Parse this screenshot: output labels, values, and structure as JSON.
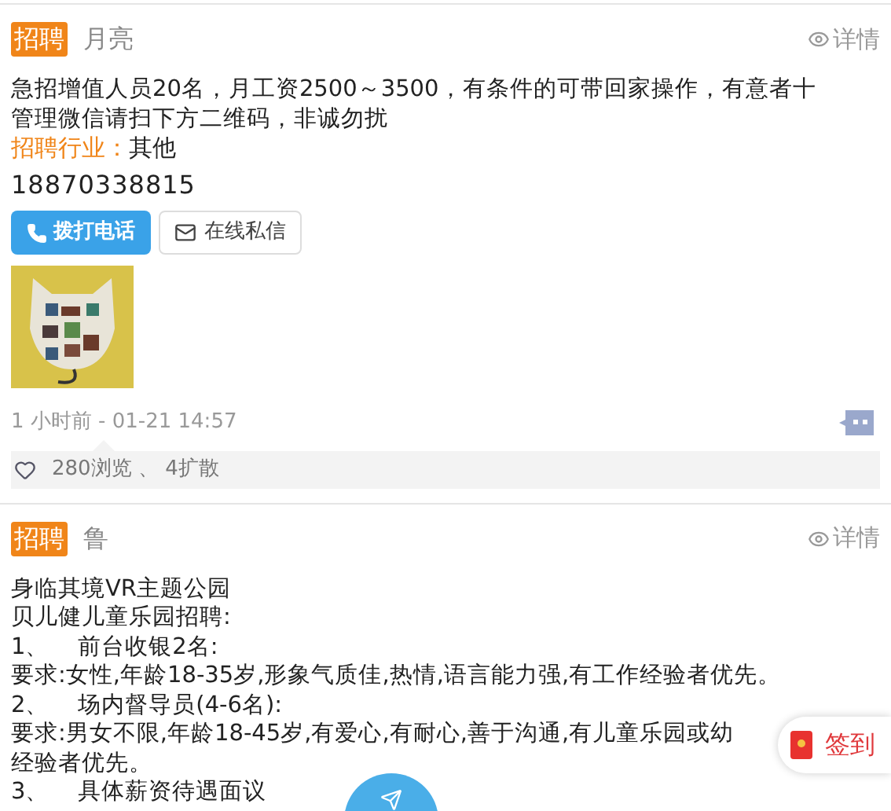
{
  "posts": [
    {
      "tag": "招聘",
      "author": "月亮",
      "detail_link": "详情",
      "lines": [
        "急招增值人员20名，月工资2500～3500，有条件的可带回家操作，有意者十管理微信请扫下方二维码，非诚勿扰"
      ],
      "industry_label": "招聘行业：",
      "industry": "其他",
      "phone": "18870338815",
      "buttons": [
        {
          "label": "拨打电话",
          "kind": "call"
        },
        {
          "label": "在线私信",
          "kind": "message"
        }
      ],
      "image": {
        "kind": "picture"
      },
      "time": "1 小时前 - 01-21 14:57",
      "stats": "280浏览 、 4扩散"
    },
    {
      "tag": "招聘",
      "author": "鲁",
      "detail_link": "详情",
      "lines": [
        "身临其境VR主题公园",
        "贝儿健儿童乐园招聘:",
        "1、    前台收银2名:",
        "要求:女性,年龄18-35岁,形象气质佳,热情,语言能力强,有工作经验者优先。",
        "2、    场内督导员(4-6名):",
        "要求:男女不限,年龄18-45岁,有爱心,有耐心,善于沟通,有儿童乐园或幼",
        "经验者优先。",
        "3、    具体薪资待遇面议"
      ]
    }
  ],
  "floating_checkin": {
    "label": "签到"
  }
}
